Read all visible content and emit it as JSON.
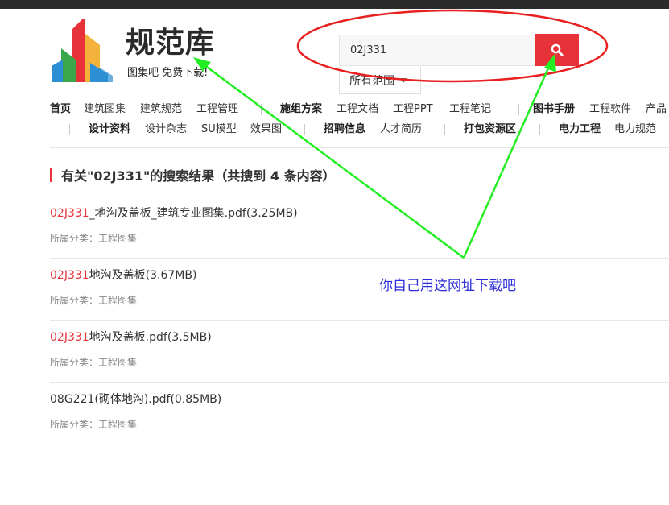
{
  "logo": {
    "name": "规范库",
    "slogan": "图集吧 免费下载!"
  },
  "search": {
    "value": "02J331",
    "scope": "所有范围"
  },
  "nav": {
    "row1": [
      {
        "label": "首页",
        "bold": true
      },
      {
        "label": "建筑图集",
        "bold": false
      },
      {
        "label": "建筑规范",
        "bold": false
      },
      {
        "label": "工程管理",
        "bold": false
      },
      {
        "label": "施组方案",
        "bold": true
      },
      {
        "label": "工程文档",
        "bold": false
      },
      {
        "label": "工程PPT",
        "bold": false
      },
      {
        "label": "工程笔记",
        "bold": false
      },
      {
        "label": "图书手册",
        "bold": true
      },
      {
        "label": "工程软件",
        "bold": false
      },
      {
        "label": "产品",
        "bold": false
      }
    ],
    "row2": [
      {
        "label": "设计资料",
        "bold": true
      },
      {
        "label": "设计杂志",
        "bold": false
      },
      {
        "label": "SU模型",
        "bold": false
      },
      {
        "label": "效果图",
        "bold": false
      },
      {
        "label": "招聘信息",
        "bold": true
      },
      {
        "label": "人才简历",
        "bold": false
      },
      {
        "label": "打包资源区",
        "bold": true
      },
      {
        "label": "电力工程",
        "bold": true
      },
      {
        "label": "电力规范",
        "bold": false
      }
    ]
  },
  "results": {
    "heading": "有关\"02J331\"的搜索结果（共搜到 4 条内容）",
    "items": [
      {
        "highlight": "02J331",
        "rest": "_地沟及盖板_建筑专业图集.pdf(3.25MB)",
        "category": "所属分类：工程图集"
      },
      {
        "highlight": "02J331",
        "rest": "地沟及盖板(3.67MB)",
        "category": "所属分类：工程图集"
      },
      {
        "highlight": "02J331",
        "rest": "地沟及盖板.pdf(3.5MB)",
        "category": "所属分类：工程图集"
      },
      {
        "highlight": "",
        "rest": "08G221(砌体地沟).pdf(0.85MB)",
        "category": "所属分类：工程图集"
      }
    ]
  },
  "annotation": {
    "text": "你自己用这网址下载吧"
  },
  "colors": {
    "accent": "#e8323a",
    "annotation": "#2b2bd9",
    "arrow": "#22ee22"
  },
  "icons": {
    "search": "magnifier-icon",
    "caret": "caret-down-icon"
  }
}
